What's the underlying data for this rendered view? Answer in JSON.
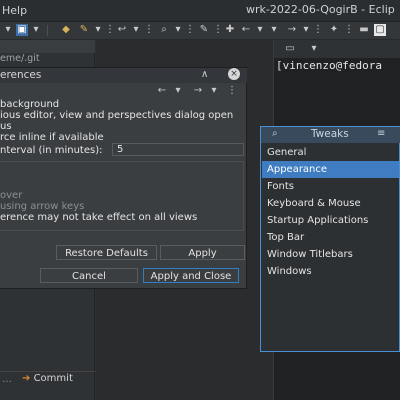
{
  "window": {
    "menu_help": "Help",
    "title": "wrk-2022-06-QogirB - Eclip"
  },
  "explorer": {
    "path": "eme/.git",
    "commit_label": "Commit"
  },
  "terminal": {
    "prompt": "[vincenzo@fedora"
  },
  "preferences": {
    "title": "erences",
    "lines": [
      "background",
      "ious editor, view and perspectives dialog open",
      "us",
      "rce inline if available",
      "nterval (in minutes):"
    ],
    "interval_value": "5",
    "dim_lines": [
      "over",
      "using arrow keys"
    ],
    "note": "erence may not take effect on all views",
    "restore_defaults": "Restore Defaults",
    "apply": "Apply",
    "cancel": "Cancel",
    "apply_close": "Apply and Close"
  },
  "tweaks": {
    "title": "Tweaks",
    "items": [
      {
        "label": "General"
      },
      {
        "label": "Appearance"
      },
      {
        "label": "Fonts"
      },
      {
        "label": "Keyboard & Mouse"
      },
      {
        "label": "Startup Applications"
      },
      {
        "label": "Top Bar"
      },
      {
        "label": "Window Titlebars"
      },
      {
        "label": "Windows"
      }
    ],
    "selected": "Appearance"
  },
  "colors": {
    "accent": "#3f7cc2",
    "tweaks_border": "#4a90d9",
    "background": "#2e3134"
  }
}
